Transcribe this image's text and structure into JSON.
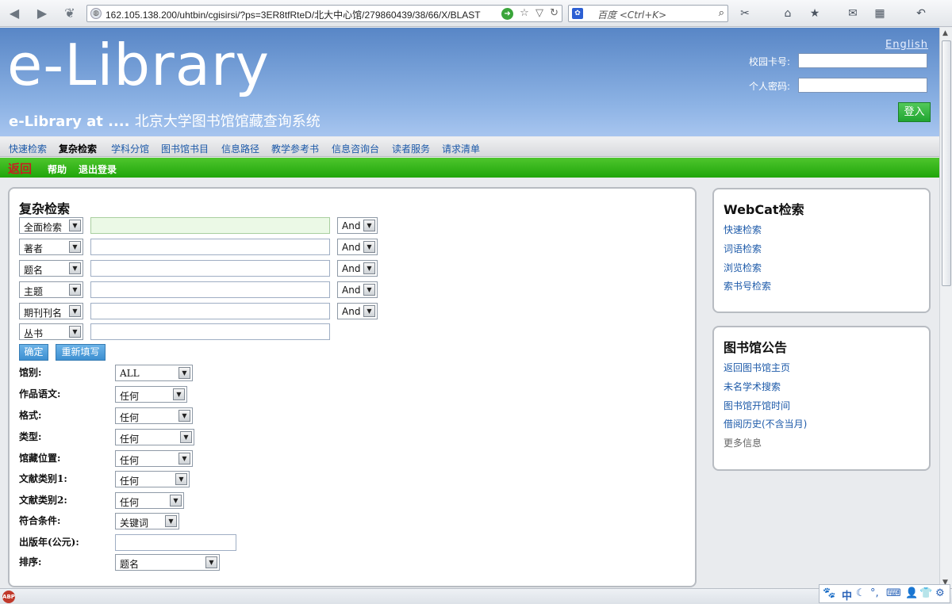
{
  "browser": {
    "url": "162.105.138.200/uhtbin/cgisirsi/?ps=3ER8tfRteD/北大中心馆/279860439/38/66/X/BLAST",
    "search_placeholder": "百度 <Ctrl+K>"
  },
  "header": {
    "logo": "e-Library",
    "subtitle_en": "e-Library at ....",
    "subtitle_cn": "北京大学图书馆馆藏查询系统",
    "english_link": "English",
    "card_label": "校园卡号:",
    "password_label": "个人密码:",
    "login_button": "登入"
  },
  "nav": {
    "items": [
      "快速检索",
      "复杂检索",
      "学科分馆",
      "图书馆书目",
      "信息路径",
      "教学参考书",
      "信息咨询台",
      "读者服务",
      "请求清单"
    ]
  },
  "actions": {
    "back": "返回",
    "help": "帮助",
    "logout": "退出登录"
  },
  "search": {
    "title": "复杂检索",
    "rows": [
      {
        "field": "全面检索",
        "op": "And"
      },
      {
        "field": "著者",
        "op": "And"
      },
      {
        "field": "题名",
        "op": "And"
      },
      {
        "field": "主题",
        "op": "And"
      },
      {
        "field": "期刊刊名",
        "op": "And"
      },
      {
        "field": "丛书"
      }
    ],
    "submit": "确定",
    "reset": "重新填写",
    "filters": [
      {
        "label": "馆别:",
        "value": "ALL"
      },
      {
        "label": "作品语文:",
        "value": "任何"
      },
      {
        "label": "格式:",
        "value": "任何"
      },
      {
        "label": "类型:",
        "value": "任何"
      },
      {
        "label": "馆藏位置:",
        "value": "任何"
      },
      {
        "label": "文献类别1:",
        "value": "任何"
      },
      {
        "label": "文献类别2:",
        "value": "任何"
      },
      {
        "label": "符合条件:",
        "value": "关键词"
      },
      {
        "label": "出版年(公元):",
        "value": ""
      },
      {
        "label": "排序:",
        "value": "题名"
      }
    ]
  },
  "webcat": {
    "title": "WebCat检索",
    "links": [
      "快速检索",
      "词语检索",
      "浏览检索",
      "索书号检索"
    ]
  },
  "notice": {
    "title": "图书馆公告",
    "links": [
      "返回图书馆主页",
      "未名学术搜索",
      "图书馆开馆时间",
      "借阅历史(不含当月)"
    ],
    "more": "更多信息"
  },
  "statusbar": {
    "abp": "ABP",
    "ime_lang": "中"
  }
}
